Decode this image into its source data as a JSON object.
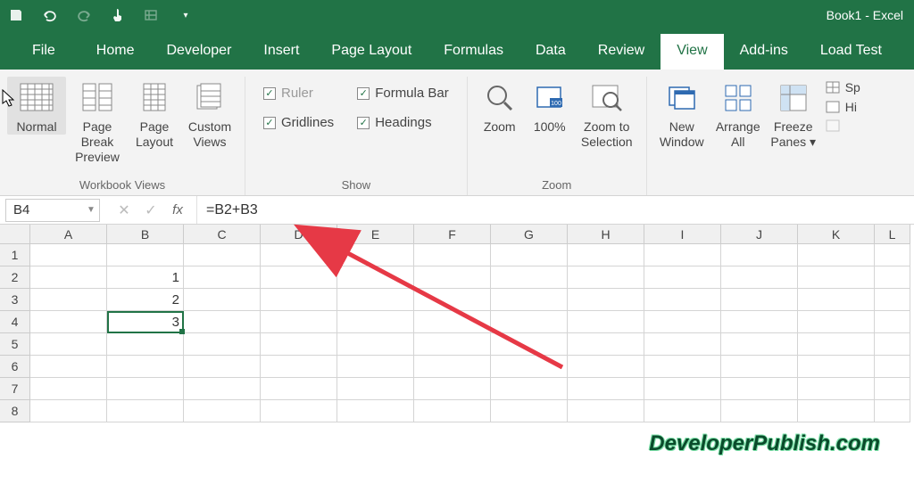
{
  "title": "Book1 - Excel",
  "tabs": [
    "File",
    "Home",
    "Developer",
    "Insert",
    "Page Layout",
    "Formulas",
    "Data",
    "Review",
    "View",
    "Add-ins",
    "Load Test"
  ],
  "activeTab": "View",
  "ribbon": {
    "workbookViews": {
      "label": "Workbook Views",
      "normal": "Normal",
      "pageBreak": "Page Break Preview",
      "pageLayout": "Page Layout",
      "customViews": "Custom Views"
    },
    "show": {
      "label": "Show",
      "ruler": "Ruler",
      "gridlines": "Gridlines",
      "formulaBar": "Formula Bar",
      "headings": "Headings"
    },
    "zoom": {
      "label": "Zoom",
      "zoom": "Zoom",
      "hundred": "100%",
      "toSelection": "Zoom to Selection"
    },
    "window": {
      "newWindow": "New Window",
      "arrangeAll": "Arrange All",
      "freezePanes": "Freeze Panes ▾"
    },
    "extra": {
      "sp": "Sp",
      "hi": "Hi"
    }
  },
  "nameBox": "B4",
  "formula": "=B2+B3",
  "columns": [
    "A",
    "B",
    "C",
    "D",
    "E",
    "F",
    "G",
    "H",
    "I",
    "J",
    "K",
    "L"
  ],
  "rows": [
    "1",
    "2",
    "3",
    "4",
    "5",
    "6",
    "7",
    "8"
  ],
  "cells": {
    "B2": "1",
    "B3": "2",
    "B4": "3"
  },
  "watermark": "DeveloperPublish.com"
}
